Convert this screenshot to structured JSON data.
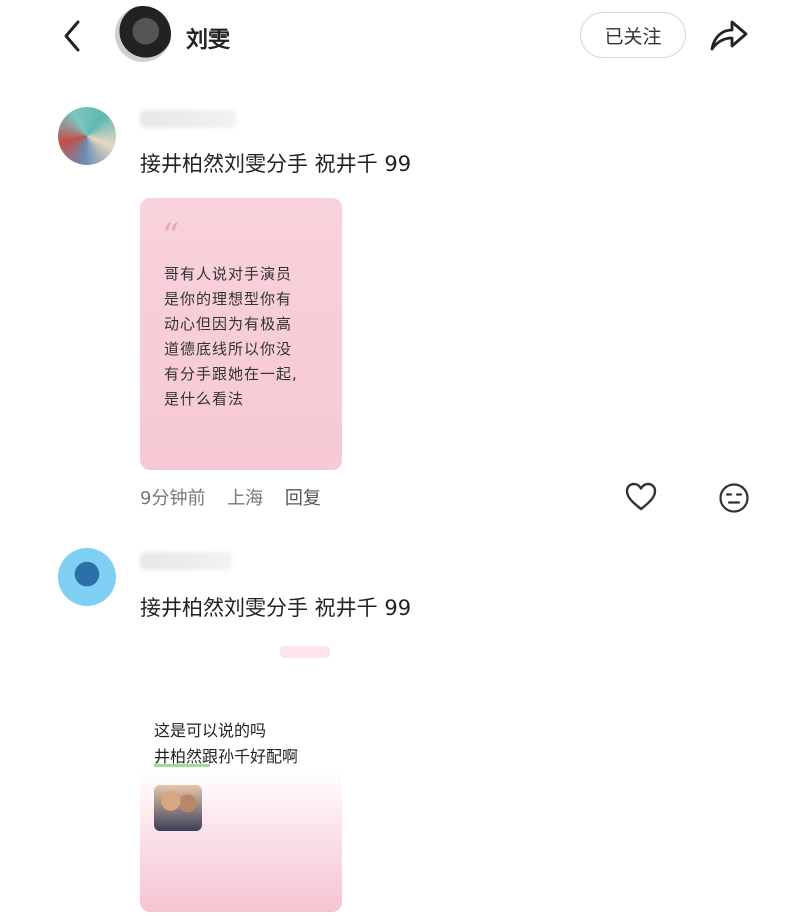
{
  "header": {
    "name": "刘雯",
    "follow_label": "已关注"
  },
  "comments": [
    {
      "text": "接井柏然刘雯分手 祝井千 99",
      "card_text": [
        "哥有人说对手演员",
        "是你的理想型你有",
        "动心但因为有极高",
        "道德底线所以你没",
        "有分手跟她在一起,",
        "是什么看法"
      ],
      "time": "9分钟前",
      "location": "上海",
      "reply_label": "回复"
    },
    {
      "text": "接井柏然刘雯分手 祝井千 99",
      "card_text": [
        "这是可以说的吗",
        "井柏然跟孙千好配啊"
      ]
    }
  ],
  "icons": {
    "back": "chevron-left-icon",
    "share": "share-arrow-icon",
    "like": "heart-outline-icon",
    "emoji": "neutral-face-icon",
    "quote": "quote-mark-icon"
  },
  "colors": {
    "card_pink": "#f8d2dc",
    "text_dark": "#222222",
    "meta_gray": "#777777",
    "highlight_green": "#9ddc9a"
  }
}
